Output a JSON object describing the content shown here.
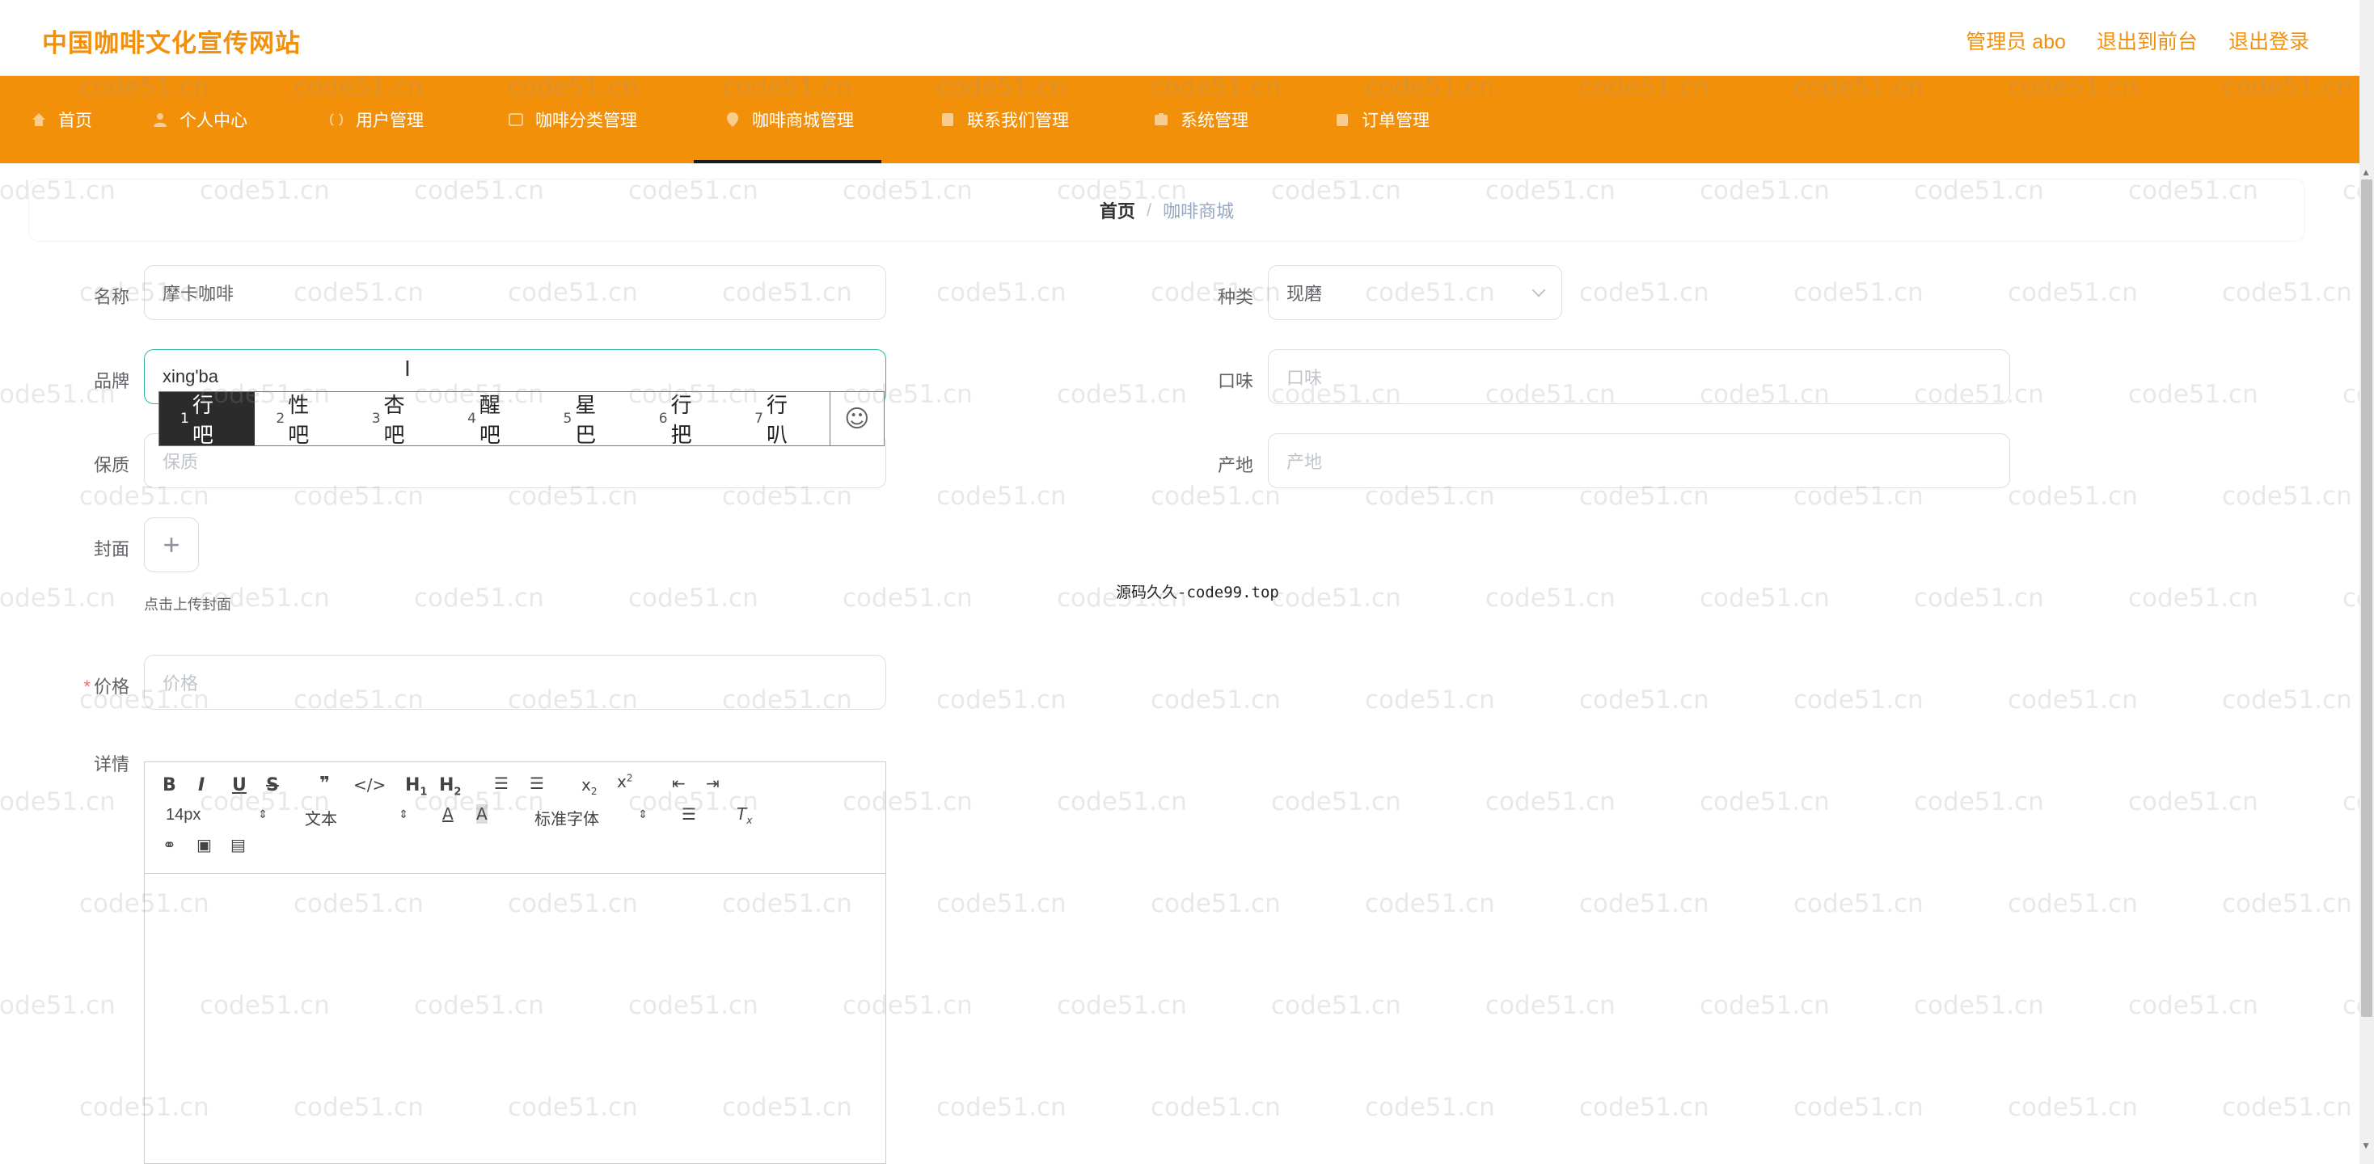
{
  "header": {
    "site_title": "中国咖啡文化宣传网站",
    "admin_label": "管理员 abo",
    "to_frontend": "退出到前台",
    "logout": "退出登录"
  },
  "nav": {
    "items": [
      {
        "label": "首页",
        "icon": "home-icon"
      },
      {
        "label": "个人中心",
        "icon": "user-icon"
      },
      {
        "label": "用户管理",
        "icon": "users-icon"
      },
      {
        "label": "咖啡分类管理",
        "icon": "category-icon"
      },
      {
        "label": "咖啡商城管理",
        "icon": "shop-icon",
        "active": true
      },
      {
        "label": "联系我们管理",
        "icon": "contact-icon"
      },
      {
        "label": "系统管理",
        "icon": "system-icon"
      },
      {
        "label": "订单管理",
        "icon": "order-icon"
      }
    ]
  },
  "breadcrumb": {
    "home": "首页",
    "sep": "/",
    "current": "咖啡商城"
  },
  "form": {
    "name_label": "名称",
    "name_value": "摩卡咖啡",
    "category_label": "种类",
    "category_value": "现磨",
    "brand_label": "品牌",
    "brand_value": "xing'ba",
    "taste_label": "口味",
    "taste_placeholder": "口味",
    "shelf_label": "保质",
    "shelf_placeholder": "保质",
    "origin_label": "产地",
    "origin_placeholder": "产地",
    "cover_label": "封面",
    "cover_hint": "点击上传封面",
    "price_label": "价格",
    "price_required": "*",
    "price_placeholder": "价格",
    "detail_label": "详情"
  },
  "ime": {
    "candidates": [
      {
        "n": "1",
        "text": "行吧"
      },
      {
        "n": "2",
        "text": "性吧"
      },
      {
        "n": "3",
        "text": "杏吧"
      },
      {
        "n": "4",
        "text": "醒吧"
      },
      {
        "n": "5",
        "text": "星巴"
      },
      {
        "n": "6",
        "text": "行把"
      },
      {
        "n": "7",
        "text": "行叭"
      }
    ],
    "emoji": "☺"
  },
  "editor": {
    "font_size": "14px",
    "block_type": "文本",
    "font_family": "标准字体"
  },
  "center_note": "源码久久-code99.top",
  "watermark": "code51.cn",
  "colors": {
    "accent": "#f39009",
    "title": "#f0900d",
    "focus_border": "#2fb79a"
  }
}
